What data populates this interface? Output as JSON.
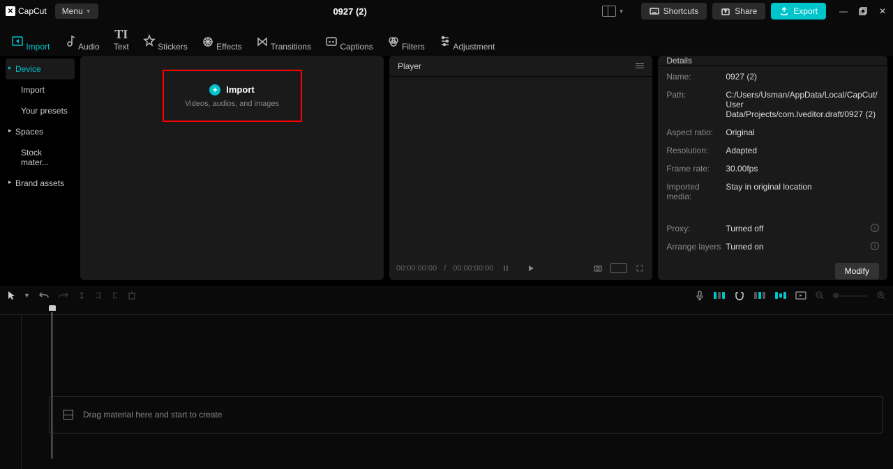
{
  "app": {
    "name": "CapCut",
    "menu_label": "Menu"
  },
  "project": {
    "title": "0927 (2)"
  },
  "top_buttons": {
    "shortcuts": "Shortcuts",
    "share": "Share",
    "export": "Export"
  },
  "tabs": [
    {
      "label": "Import"
    },
    {
      "label": "Audio"
    },
    {
      "label": "Text"
    },
    {
      "label": "Stickers"
    },
    {
      "label": "Effects"
    },
    {
      "label": "Transitions"
    },
    {
      "label": "Captions"
    },
    {
      "label": "Filters"
    },
    {
      "label": "Adjustment"
    }
  ],
  "sidebar": [
    {
      "label": "Device",
      "expandable": true,
      "active": true
    },
    {
      "label": "Import",
      "expandable": false
    },
    {
      "label": "Your presets",
      "expandable": false
    },
    {
      "label": "Spaces",
      "expandable": true
    },
    {
      "label": "Stock mater...",
      "expandable": false
    },
    {
      "label": "Brand assets",
      "expandable": true
    }
  ],
  "import_box": {
    "title": "Import",
    "subtitle": "Videos, audios, and images"
  },
  "player": {
    "header": "Player",
    "current": "00:00:00:00",
    "separator": " / ",
    "total": "00:00:00:00"
  },
  "details": {
    "header": "Details",
    "name_label": "Name:",
    "name": "0927 (2)",
    "path_label": "Path:",
    "path": "C:/Users/Usman/AppData/Local/CapCut/User Data/Projects/com.lveditor.draft/0927 (2)",
    "aspect_label": "Aspect ratio:",
    "aspect": "Original",
    "resolution_label": "Resolution:",
    "resolution": "Adapted",
    "framerate_label": "Frame rate:",
    "framerate": "30.00fps",
    "imported_label": "Imported media:",
    "imported": "Stay in original location",
    "proxy_label": "Proxy:",
    "proxy": "Turned off",
    "layers_label": "Arrange layers",
    "layers": "Turned on",
    "modify": "Modify"
  },
  "timeline": {
    "drop_hint": "Drag material here and start to create"
  }
}
